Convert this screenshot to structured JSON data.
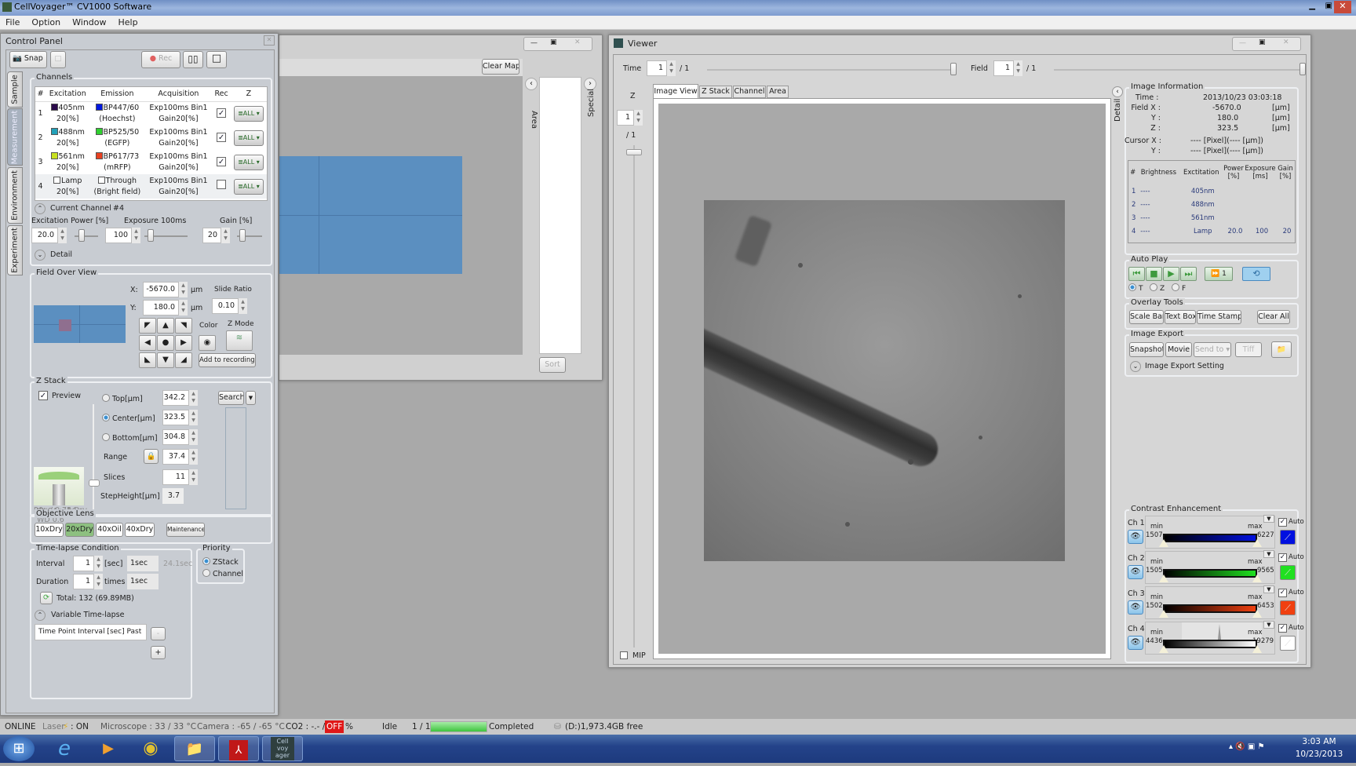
{
  "app": {
    "title": "CellVoyager™ CV1000 Software",
    "menu": [
      "File",
      "Option",
      "Window",
      "Help"
    ]
  },
  "control_panel": {
    "title": "Control Panel",
    "toolbar": {
      "snap": "Snap",
      "rec": "Rec"
    },
    "side_tabs": [
      "Sample",
      "Measurement",
      "Environment",
      "Experiment"
    ],
    "channels": {
      "title": "Channels",
      "headers": [
        "#",
        "Excitation",
        "Emission",
        "Acquisition",
        "Rec",
        "Z"
      ],
      "rows": [
        {
          "num": "1",
          "ex": "405nm",
          "ex_pct": "20[%]",
          "ex_color": "#2a0a4a",
          "em": "BP447/60",
          "em_sub": "(Hoechst)",
          "em_color": "#0018e0",
          "acq1": "Exp100ms Bin1",
          "acq2": "Gain20[%]",
          "rec": true,
          "z": "ALL"
        },
        {
          "num": "2",
          "ex": "488nm",
          "ex_pct": "20[%]",
          "ex_color": "#22a0b8",
          "em": "BP525/50",
          "em_sub": "(EGFP)",
          "em_color": "#30d030",
          "acq1": "Exp100ms Bin1",
          "acq2": "Gain20[%]",
          "rec": true,
          "z": "ALL"
        },
        {
          "num": "3",
          "ex": "561nm",
          "ex_pct": "20[%]",
          "ex_color": "#c8e020",
          "em": "BP617/73",
          "em_sub": "(mRFP)",
          "em_color": "#e84020",
          "acq1": "Exp100ms Bin1",
          "acq2": "Gain20[%]",
          "rec": true,
          "z": "ALL"
        },
        {
          "num": "4",
          "ex": "Lamp",
          "ex_pct": "20[%]",
          "ex_color": "#ffffff",
          "em": "Through",
          "em_sub": "(Bright field)",
          "em_color": "#ffffff",
          "acq1": "Exp100ms Bin1",
          "acq2": "Gain20[%]",
          "rec": false,
          "z": "ALL"
        }
      ],
      "current_channel": "Current Channel",
      "current_channel_num": "#4",
      "excitation_power_label": "Excitation  Power [%]",
      "exposure_label": "Exposure",
      "exposure_value_label": "100ms",
      "gain_label": "Gain [%]",
      "power": "20.0",
      "exposure": "100",
      "gain": "20",
      "detail": "Detail"
    },
    "field_overview": {
      "title": "Field Over View",
      "x_label": "X:",
      "x": "-5670.0",
      "y_label": "Y:",
      "y": "180.0",
      "unit": "µm",
      "slide_ratio_label": "Slide Ratio",
      "slide_ratio": "0.10",
      "color_label": "Color",
      "zmode_label": "Z Mode",
      "add_to_recordings": "Add to recordings"
    },
    "z_stack": {
      "title": "Z Stack",
      "preview": "Preview",
      "preview_checked": true,
      "top_label": "Top[µm]",
      "top": "342.2",
      "center_label": "Center[µm]",
      "center": "323.5",
      "bottom_label": "Bottom[µm]",
      "bottom": "304.8",
      "range_label": "Range",
      "range": "37.4",
      "slices_label": "Slices",
      "slices": "11",
      "step_label": "StepHeight[µm]",
      "step": "3.7",
      "search": "Search",
      "lens_name": "UPLSApo20x",
      "lens_spec": "20x / 0.75 Dry",
      "lens_wd": "WD 0.6"
    },
    "objective": {
      "title": "Objective Lens",
      "lenses": [
        "10xDry",
        "20xDry",
        "40xOil",
        "40xDry"
      ],
      "selected": "20xDry",
      "maintenance": "Maintenance"
    },
    "timelapse": {
      "title": "Time-lapse Condition",
      "interval_label": "Interval",
      "interval": "1",
      "interval_unit": "[sec]",
      "interval_text": "1sec",
      "interval_hint": "24.1sec",
      "duration_label": "Duration",
      "duration": "1",
      "duration_unit": "times",
      "duration_text": "1sec",
      "total": "Total:  132 (69.89MB)",
      "variable": "Variable Time-lapse",
      "var_headers": [
        "Time Point",
        "Interval [sec]",
        "Past"
      ],
      "minus": "-",
      "plus": "+"
    },
    "priority": {
      "title": "Priority",
      "options": [
        "ZStack",
        "Channel"
      ],
      "selected": "ZStack"
    }
  },
  "map_window": {
    "clear_map": "Clear Map",
    "area": "Area",
    "special": "Special",
    "sort": "Sort"
  },
  "viewer": {
    "title": "Viewer",
    "time_label": "Time",
    "time": "1",
    "time_total": "/ 1",
    "field_label": "Field",
    "field": "1",
    "field_total": "/ 1",
    "z_label": "Z",
    "z": "1",
    "z_total": "/ 1",
    "tabs": [
      "Image View",
      "Z Stack",
      "Channel",
      "Area"
    ],
    "active_tab": "Image View",
    "mip": "MIP",
    "detail": "Detail",
    "image_info": {
      "title": "Image Information",
      "time_label": "Time :",
      "time": "2013/10/23 03:03:18",
      "fx_label": "Field X :",
      "fx": "-5670.0",
      "fy_label": "Y :",
      "fy": "180.0",
      "fz_label": "Z :",
      "fz": "323.5",
      "unit": "[µm]",
      "cx_label": "Cursor X :",
      "cx": "---- [Pixel](---- [µm])",
      "cy_label": "Y :",
      "cy": "---- [Pixel](---- [µm])",
      "headers": [
        "#",
        "Brightness",
        "Exctitation",
        "Power [%]",
        "Exposure [ms]",
        "Gain [%]"
      ],
      "rows": [
        [
          "1",
          "----",
          "405nm",
          "",
          "",
          ""
        ],
        [
          "2",
          "----",
          "488nm",
          "",
          "",
          ""
        ],
        [
          "3",
          "----",
          "561nm",
          "",
          "",
          ""
        ],
        [
          "4",
          "----",
          "Lamp",
          "20.0",
          "100",
          "20"
        ]
      ]
    },
    "auto_play": {
      "title": "Auto Play",
      "speed": "1",
      "modes": [
        "T",
        "Z",
        "F"
      ],
      "selected": "T"
    },
    "overlay": {
      "title": "Overlay Tools",
      "buttons": [
        "Scale Bar",
        "Text Box",
        "Time Stamp",
        "Clear All"
      ]
    },
    "export": {
      "title": "Image Export",
      "snapshot": "Snapshot",
      "movie": "Movie",
      "send_to": "Send to",
      "tiff": "Tiff",
      "setting": "Image Export Setting"
    },
    "contrast": {
      "title": "Contrast Enhancement",
      "min_label": "min",
      "max_label": "max",
      "auto_label": "Auto",
      "channels": [
        {
          "name": "Ch 1",
          "min": "1507",
          "max": "6227",
          "color": "#0010e0",
          "auto": true
        },
        {
          "name": "Ch 2",
          "min": "1505",
          "max": "9565",
          "color": "#20e020",
          "auto": true
        },
        {
          "name": "Ch 3",
          "min": "1502",
          "max": "6453",
          "color": "#f04010",
          "auto": true
        },
        {
          "name": "Ch 4",
          "min": "4436",
          "max": "19279",
          "color": "#ffffff",
          "auto": true
        }
      ]
    }
  },
  "status": {
    "online": "ONLINE",
    "laser": "Laser",
    "laser_state": ": ON",
    "microscope": "Microscope : 33 / 33 °C",
    "camera": "Camera : -65 / -65 °C",
    "co2": "CO2 : -.- /",
    "co2_off": "OFF",
    "co2_unit": "%",
    "state": "Idle",
    "progress_text": "1 / 1",
    "progress": 1.0,
    "completed": "Completed",
    "disk": "(D:)1,973.4GB free"
  },
  "taskbar": {
    "clock_time": "3:03 AM",
    "clock_date": "10/23/2013",
    "apps": [
      "start",
      "internet-explorer",
      "media-player",
      "chrome",
      "file-explorer",
      "acrobat",
      "cellvoyager"
    ],
    "cellvoyager_label": "Cell voy ager"
  }
}
